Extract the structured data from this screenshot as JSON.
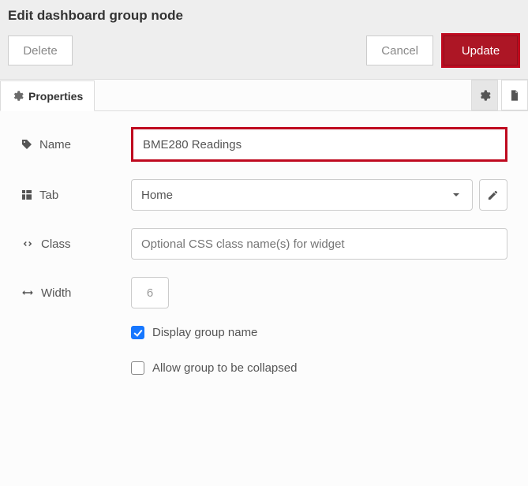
{
  "header": {
    "title": "Edit dashboard group node",
    "delete_label": "Delete",
    "cancel_label": "Cancel",
    "update_label": "Update"
  },
  "tabs": {
    "properties_label": "Properties"
  },
  "form": {
    "name": {
      "label": "Name",
      "value": "BME280 Readings"
    },
    "tab": {
      "label": "Tab",
      "value": "Home"
    },
    "class": {
      "label": "Class",
      "placeholder": "Optional CSS class name(s) for widget"
    },
    "width": {
      "label": "Width",
      "value": "6"
    },
    "display_group_name": {
      "label": "Display group name",
      "checked": true
    },
    "allow_collapse": {
      "label": "Allow group to be collapsed",
      "checked": false
    }
  },
  "icons": {
    "gear": "gear-icon",
    "doc": "document-icon",
    "tag": "tag-icon",
    "grid": "grid-icon",
    "code": "code-icon",
    "arrows_h": "arrows-h-icon",
    "chevron": "chevron-down-icon",
    "pencil": "pencil-icon"
  },
  "colors": {
    "accent_red": "#AD1625",
    "highlight_red": "#bf0a1f",
    "check_blue": "#1677ff"
  }
}
